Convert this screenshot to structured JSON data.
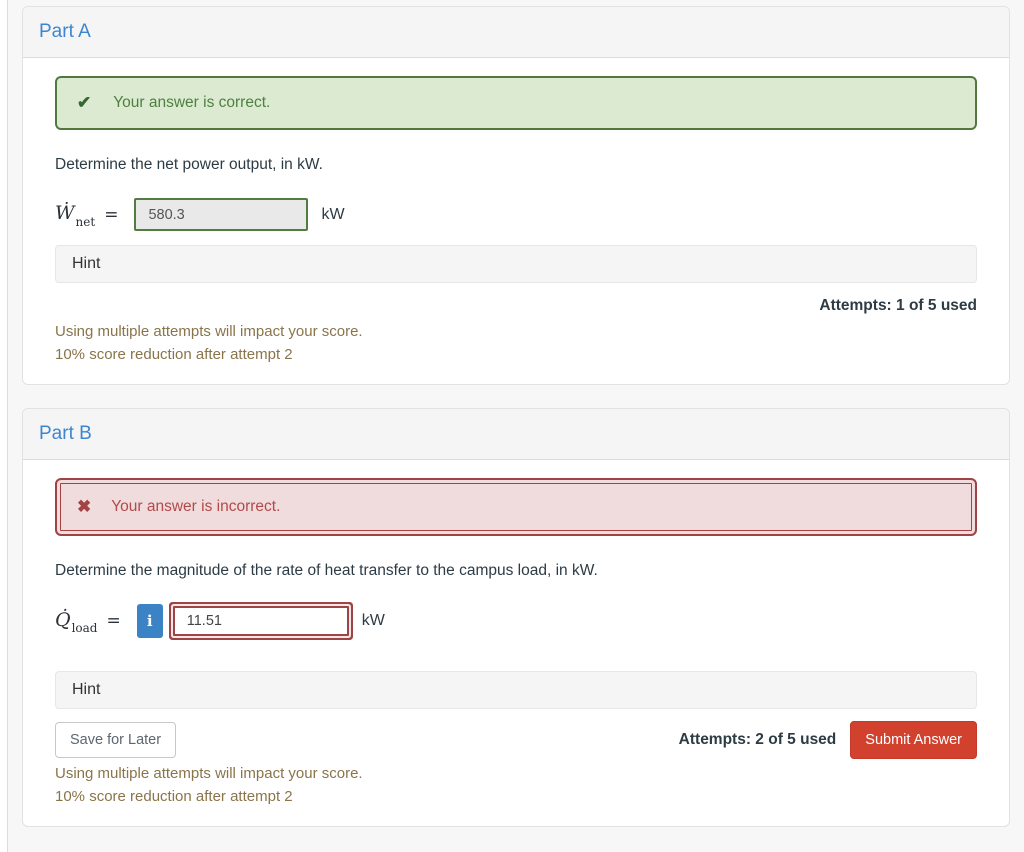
{
  "part_a": {
    "title": "Part A",
    "banner": {
      "icon": "✔",
      "text": "Your answer is correct."
    },
    "question": "Determine the net power output, in kW.",
    "formula": {
      "variable": "Ẇ",
      "subscript": "net",
      "equals": "=",
      "value": "580.3",
      "unit": "kW"
    },
    "hint_label": "Hint",
    "attempts": "Attempts: 1 of 5 used",
    "warning_line1": "Using multiple attempts will impact your score.",
    "warning_line2": "10% score reduction after attempt 2"
  },
  "part_b": {
    "title": "Part B",
    "banner": {
      "icon": "✖",
      "text": "Your answer is incorrect."
    },
    "question": "Determine the magnitude of the rate of heat transfer to the campus load, in kW.",
    "formula": {
      "variable": "Q̇",
      "subscript": "load",
      "equals": "=",
      "info_icon": "i",
      "value": "11.51",
      "unit": "kW"
    },
    "hint_label": "Hint",
    "save_label": "Save for Later",
    "attempts": "Attempts: 2 of 5 used",
    "submit_label": "Submit Answer",
    "warning_line1": "Using multiple attempts will impact your score.",
    "warning_line2": "10% score reduction after attempt 2"
  },
  "colors": {
    "accent_blue": "#3d85d1",
    "success_bg": "#dcead2",
    "success_border": "#51793f",
    "success_text": "#4c8140",
    "error_bg": "#f0dcdc",
    "error_border": "#9f4345",
    "error_text": "#b2494b",
    "warning_text": "#8a744a",
    "submit_red": "#d2402e",
    "info_blue": "#3c83c5"
  }
}
